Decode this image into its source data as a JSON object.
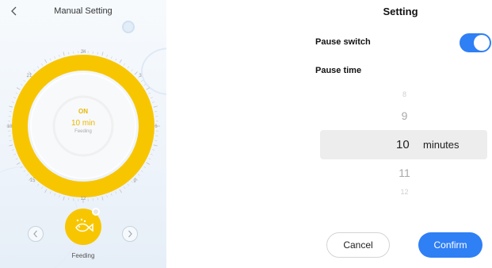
{
  "left": {
    "title": "Manual Setting",
    "dial": {
      "ticks": [
        "24",
        "3",
        "6",
        "9",
        "12",
        "15",
        "18",
        "21"
      ],
      "status": "ON",
      "duration": "10 min",
      "mode": "Feeding",
      "ring_color": "#f8c600"
    },
    "feed_button_label": "Feeding"
  },
  "right": {
    "title": "Setting",
    "pause_switch_label": "Pause switch",
    "pause_switch_on": true,
    "pause_time_label": "Pause time",
    "picker": {
      "values": [
        "8",
        "9",
        "10",
        "11",
        "12"
      ],
      "selected": "10",
      "unit": "minutes"
    },
    "cancel_label": "Cancel",
    "confirm_label": "Confirm",
    "accent_color": "#2f7ff5"
  }
}
